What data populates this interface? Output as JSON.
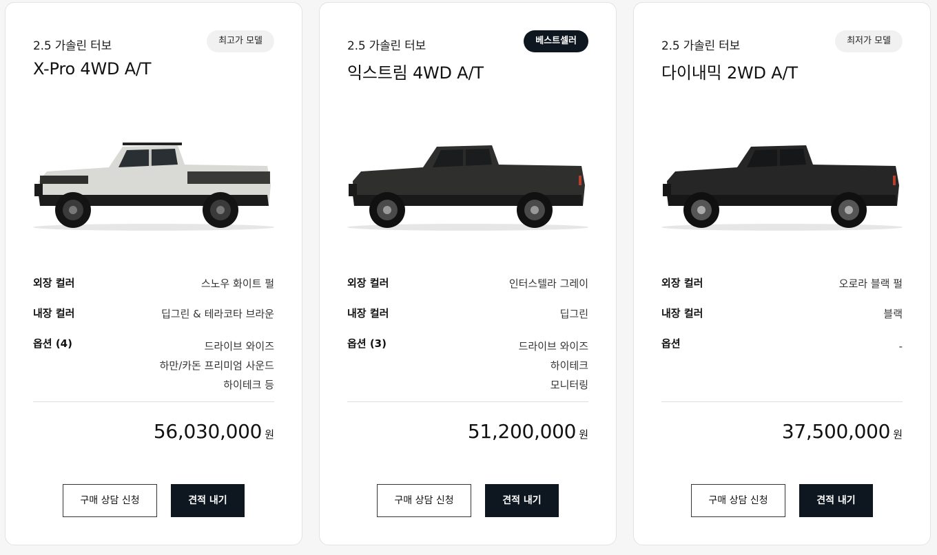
{
  "labels": {
    "exterior": "외장 컬러",
    "interior": "내장 컬러",
    "consult_button": "구매 상담 신청",
    "quote_button": "견적 내기",
    "currency": "원"
  },
  "cards": [
    {
      "engine": "2.5 가솔린 터보",
      "badge": "최고가 모델",
      "model": "X-Pro 4WD A/T",
      "exterior": "스노우 화이트 펄",
      "interior": "딥그린 & 테라코타 브라운",
      "options_label": "옵션 (4)",
      "options": [
        "드라이브 와이즈",
        "하만/카돈 프리미엄 사운드",
        "하이테크 등"
      ],
      "price": "56,030,000",
      "truck_body_color": "#d9d9d6"
    },
    {
      "engine": "2.5 가솔린 터보",
      "badge": "베스트셀러",
      "model": "익스트림 4WD A/T",
      "exterior": "인터스텔라 그레이",
      "interior": "딥그린",
      "options_label": "옵션 (3)",
      "options": [
        "드라이브 와이즈",
        "하이테크",
        "모니터링"
      ],
      "price": "51,200,000",
      "truck_body_color": "#2f2f2d"
    },
    {
      "engine": "2.5 가솔린 터보",
      "badge": "최저가 모델",
      "model": "다이내믹 2WD A/T",
      "exterior": "오로라 블랙 펄",
      "interior": "블랙",
      "options_label": "옵션",
      "options": [
        "-"
      ],
      "price": "37,500,000",
      "truck_body_color": "#262626"
    }
  ]
}
